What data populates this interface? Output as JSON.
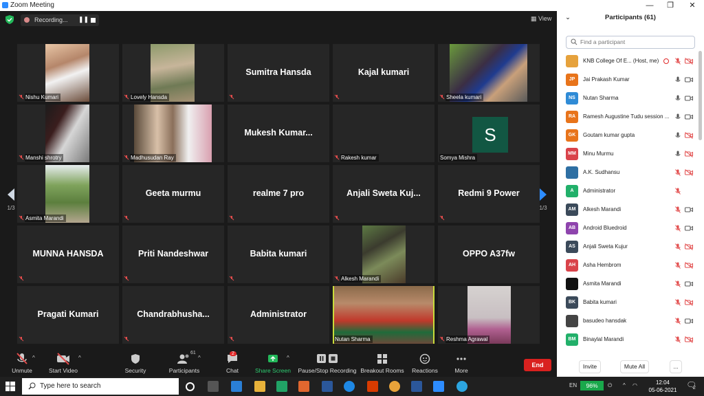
{
  "window": {
    "title": "Zoom Meeting",
    "minimize": "—",
    "maximize": "❐",
    "close": "✕"
  },
  "meeting": {
    "recording_label": "Recording...",
    "pause_glyph": "❚❚",
    "view_label": "View",
    "page_left": "1/3",
    "page_right": "1/3",
    "tiles": [
      {
        "label": "Nishu Kumari"
      },
      {
        "label": "Lovely Hansda"
      },
      {
        "name": "Sumitra Hansda"
      },
      {
        "name": "Kajal kumari"
      },
      {
        "label": "Sheela kumari"
      },
      {
        "label": "Manshi shrotry"
      },
      {
        "label": "Madhusudan Ray"
      },
      {
        "name": "Mukesh  Kumar..."
      },
      {
        "label": "Rakesh kumar"
      },
      {
        "label": "Somya Mishra",
        "avatar_letter": "S"
      },
      {
        "label": "Asmita Marandi"
      },
      {
        "name": "Geeta murmu"
      },
      {
        "name": "realme 7 pro"
      },
      {
        "name": "Anjali  Sweta  Kuj..."
      },
      {
        "name": "Redmi 9 Power"
      },
      {
        "name": "MUNNA HANSDA"
      },
      {
        "name": "Priti Nandeshwar"
      },
      {
        "name": "Babita kumari"
      },
      {
        "label": "Alkesh Marandi"
      },
      {
        "name": "OPPO A37fw"
      },
      {
        "name": "Pragati Kumari"
      },
      {
        "name": "Chandrabhusha..."
      },
      {
        "name": "Administrator"
      },
      {
        "label": "Nutan Sharma",
        "active": true
      },
      {
        "label": "Reshma Agrawal"
      }
    ]
  },
  "toolbar": {
    "unmute": "Unmute",
    "start_video": "Start Video",
    "security": "Security",
    "participants": "Participants",
    "participants_count": "61",
    "chat": "Chat",
    "chat_badge": "2",
    "share_screen": "Share Screen",
    "pause_stop_recording": "Pause/Stop Recording",
    "breakout_rooms": "Breakout Rooms",
    "reactions": "Reactions",
    "more": "More",
    "end": "End"
  },
  "participants_panel": {
    "title": "Participants (61)",
    "search_placeholder": "Find a participant",
    "invite": "Invite",
    "mute_all": "Mute All",
    "more": "...",
    "list": [
      {
        "name": "KNB College Of E...   (Host, me)",
        "initials": "",
        "color": "#e6a23c",
        "mic": "muted",
        "video": "off",
        "recording": true
      },
      {
        "name": "Jai Prakash Kumar",
        "initials": "JP",
        "color": "#e8741b",
        "mic": "on",
        "video": "on"
      },
      {
        "name": "Nutan Sharma",
        "initials": "NS",
        "color": "#2f8bd6",
        "mic": "on",
        "video": "on"
      },
      {
        "name": "Ramesh Augustine Tudu session ...",
        "initials": "RA",
        "color": "#e8741b",
        "mic": "on",
        "video": "on"
      },
      {
        "name": "Goutam kumar gupta",
        "initials": "GK",
        "color": "#e8741b",
        "mic": "on",
        "video": "off"
      },
      {
        "name": "Minu Murmu",
        "initials": "MM",
        "color": "#d9434a",
        "mic": "on",
        "video": "off"
      },
      {
        "name": "A.K. Sudhansu",
        "initials": "",
        "color": "#2e6fa3",
        "mic": "muted",
        "video": "off"
      },
      {
        "name": "Administrator",
        "initials": "A",
        "color": "#22b06a",
        "mic": "muted",
        "video": ""
      },
      {
        "name": "Alkesh Marandi",
        "initials": "AM",
        "color": "#3b4a5a",
        "mic": "muted",
        "video": "on"
      },
      {
        "name": "Android Bluedroid",
        "initials": "AB",
        "color": "#8e44ad",
        "mic": "muted",
        "video": "on"
      },
      {
        "name": "Anjali Sweta Kujur",
        "initials": "AS",
        "color": "#3b4a5a",
        "mic": "muted",
        "video": "off"
      },
      {
        "name": "Asha Hembrom",
        "initials": "AH",
        "color": "#d9434a",
        "mic": "muted",
        "video": "off"
      },
      {
        "name": "Asmita Marandi",
        "initials": "",
        "color": "#111111",
        "mic": "muted",
        "video": "on"
      },
      {
        "name": "Babita kumari",
        "initials": "BK",
        "color": "#3b4a5a",
        "mic": "muted",
        "video": "off"
      },
      {
        "name": "basudeo hansdak",
        "initials": "",
        "color": "#444444",
        "mic": "muted",
        "video": "on"
      },
      {
        "name": "Binaylal Marandi",
        "initials": "BM",
        "color": "#22b06a",
        "mic": "muted",
        "video": "off"
      }
    ]
  },
  "taskbar": {
    "search_placeholder": "Type here to search",
    "language": "EN",
    "battery": "96%",
    "time": "12:04",
    "date": "05-06-2021",
    "notification_count": "2"
  }
}
